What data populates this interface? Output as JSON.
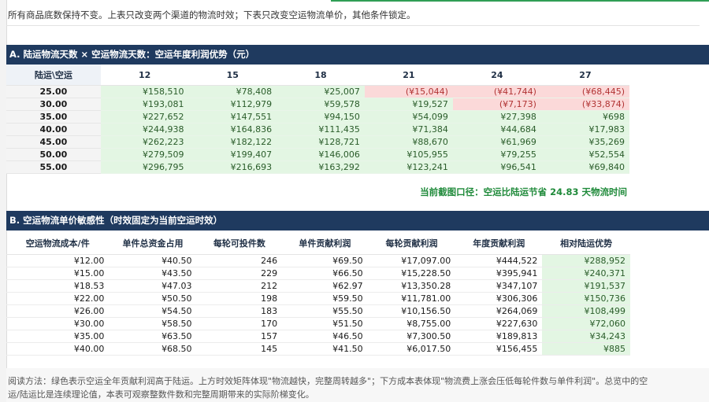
{
  "note": "所有商品底数保持不变。上表只改变两个渠道的物流时效；下表只改变空运物流单价，其他条件锁定。",
  "sectionA": {
    "title": "A. 陆运物流天数 × 空运物流天数：空运年度利润优势（元）",
    "corner": "陆运\\空运",
    "columns": [
      "12",
      "15",
      "18",
      "21",
      "24",
      "27"
    ],
    "rows": [
      {
        "label": "25.00",
        "values": [
          "¥158,510",
          "¥78,408",
          "¥25,007",
          "(¥15,044)",
          "(¥41,744)",
          "(¥68,445)"
        ],
        "neg": [
          false,
          false,
          false,
          true,
          true,
          true
        ]
      },
      {
        "label": "30.00",
        "values": [
          "¥193,081",
          "¥112,979",
          "¥59,578",
          "¥19,527",
          "(¥7,173)",
          "(¥33,874)"
        ],
        "neg": [
          false,
          false,
          false,
          false,
          true,
          true
        ]
      },
      {
        "label": "35.00",
        "values": [
          "¥227,652",
          "¥147,551",
          "¥94,150",
          "¥54,099",
          "¥27,398",
          "¥698"
        ],
        "neg": [
          false,
          false,
          false,
          false,
          false,
          false
        ]
      },
      {
        "label": "40.00",
        "values": [
          "¥244,938",
          "¥164,836",
          "¥111,435",
          "¥71,384",
          "¥44,684",
          "¥17,983"
        ],
        "neg": [
          false,
          false,
          false,
          false,
          false,
          false
        ]
      },
      {
        "label": "45.00",
        "values": [
          "¥262,223",
          "¥182,122",
          "¥128,721",
          "¥88,670",
          "¥61,969",
          "¥35,269"
        ],
        "neg": [
          false,
          false,
          false,
          false,
          false,
          false
        ]
      },
      {
        "label": "50.00",
        "values": [
          "¥279,509",
          "¥199,407",
          "¥146,006",
          "¥105,955",
          "¥79,255",
          "¥52,554"
        ],
        "neg": [
          false,
          false,
          false,
          false,
          false,
          false
        ]
      },
      {
        "label": "55.00",
        "values": [
          "¥296,795",
          "¥216,693",
          "¥163,292",
          "¥123,241",
          "¥96,541",
          "¥69,840"
        ],
        "neg": [
          false,
          false,
          false,
          false,
          false,
          false
        ]
      }
    ],
    "current": "当前截图口径：空运比陆运节省 24.83 天物流时间"
  },
  "sectionB": {
    "title": "B. 空运物流单价敏感性（时效固定为当前空运时效）",
    "columns": [
      "空运物流成本/件",
      "单件总资金占用",
      "每轮可投件数",
      "单件贡献利润",
      "每轮贡献利润",
      "年度贡献利润",
      "相对陆运优势"
    ],
    "rows": [
      [
        "¥12.00",
        "¥40.50",
        "246",
        "¥69.50",
        "¥17,097.00",
        "¥444,522",
        "¥288,952"
      ],
      [
        "¥15.00",
        "¥43.50",
        "229",
        "¥66.50",
        "¥15,228.50",
        "¥395,941",
        "¥240,371"
      ],
      [
        "¥18.53",
        "¥47.03",
        "212",
        "¥62.97",
        "¥13,350.28",
        "¥347,107",
        "¥191,537"
      ],
      [
        "¥22.00",
        "¥50.50",
        "198",
        "¥59.50",
        "¥11,781.00",
        "¥306,306",
        "¥150,736"
      ],
      [
        "¥26.00",
        "¥54.50",
        "183",
        "¥55.50",
        "¥10,156.50",
        "¥264,069",
        "¥108,499"
      ],
      [
        "¥30.00",
        "¥58.50",
        "170",
        "¥51.50",
        "¥8,755.00",
        "¥227,630",
        "¥72,060"
      ],
      [
        "¥35.00",
        "¥63.50",
        "157",
        "¥46.50",
        "¥7,300.50",
        "¥189,813",
        "¥34,243"
      ],
      [
        "¥40.00",
        "¥68.50",
        "145",
        "¥41.50",
        "¥6,017.50",
        "¥156,455",
        "¥885"
      ]
    ]
  },
  "footer": {
    "line1": "阅读方法：绿色表示空运全年贡献利润高于陆运。上方时效矩阵体现\"物流越快，完整周转越多\"；下方成本表体现\"物流费上涨会压低每轮件数与单件利润\"。总览中的空",
    "line2": "运/陆运比是连续理论值，本表可观察整数件数和完整周期带来的实际阶梯变化。"
  },
  "colors": {
    "header_bg": "#1f3a5f",
    "positive_bg": "#e3f6e3",
    "negative_bg": "#fbd9d9",
    "negative_text": "#b13434",
    "highlight_text": "#1f8a3a"
  }
}
